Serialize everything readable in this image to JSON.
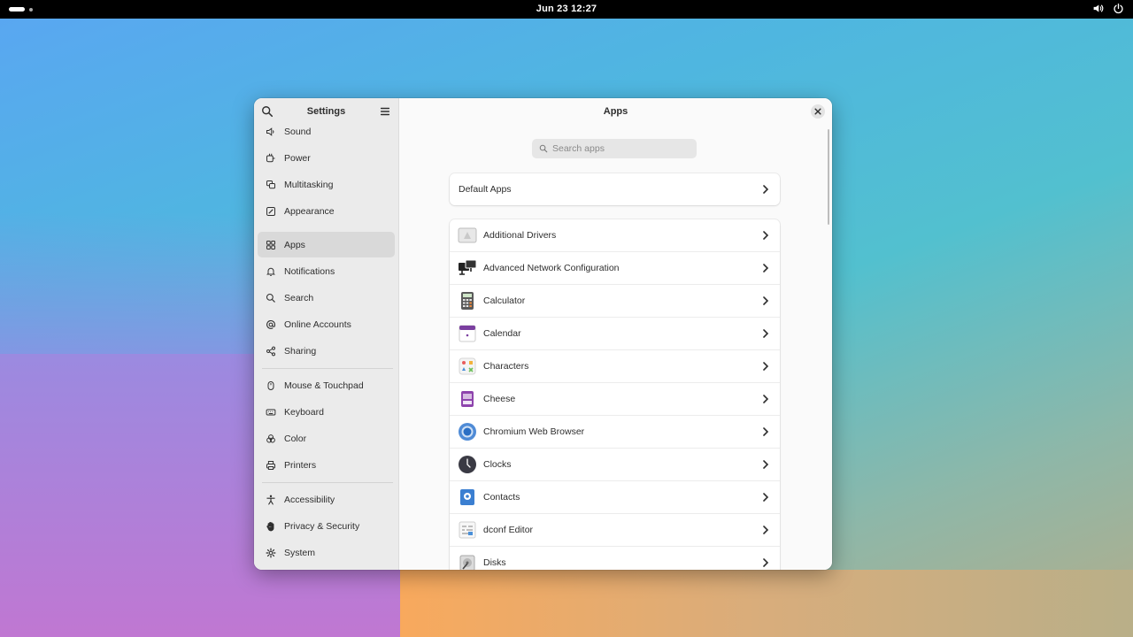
{
  "topbar": {
    "clock": "Jun 23  12:27"
  },
  "sidebar": {
    "title": "Settings",
    "items": [
      {
        "label": "Sound",
        "icon": "speaker-icon"
      },
      {
        "label": "Power",
        "icon": "power-plug-icon"
      },
      {
        "label": "Multitasking",
        "icon": "multitasking-icon"
      },
      {
        "label": "Appearance",
        "icon": "appearance-icon"
      },
      {
        "label": "Apps",
        "icon": "apps-grid-icon"
      },
      {
        "label": "Notifications",
        "icon": "bell-icon"
      },
      {
        "label": "Search",
        "icon": "search-icon"
      },
      {
        "label": "Online Accounts",
        "icon": "at-sign-icon"
      },
      {
        "label": "Sharing",
        "icon": "share-icon"
      },
      {
        "label": "Mouse & Touchpad",
        "icon": "mouse-icon"
      },
      {
        "label": "Keyboard",
        "icon": "keyboard-icon"
      },
      {
        "label": "Color",
        "icon": "color-icon"
      },
      {
        "label": "Printers",
        "icon": "printer-icon"
      },
      {
        "label": "Accessibility",
        "icon": "accessibility-icon"
      },
      {
        "label": "Privacy & Security",
        "icon": "hand-icon"
      },
      {
        "label": "System",
        "icon": "gear-icon"
      }
    ],
    "active": "Apps"
  },
  "content": {
    "title": "Apps",
    "search_placeholder": "Search apps",
    "default_apps_label": "Default Apps",
    "apps": [
      {
        "label": "Additional Drivers",
        "icon": "drivers-icon"
      },
      {
        "label": "Advanced Network Configuration",
        "icon": "network-icon"
      },
      {
        "label": "Calculator",
        "icon": "calculator-icon"
      },
      {
        "label": "Calendar",
        "icon": "calendar-icon"
      },
      {
        "label": "Characters",
        "icon": "characters-icon"
      },
      {
        "label": "Cheese",
        "icon": "cheese-icon"
      },
      {
        "label": "Chromium Web Browser",
        "icon": "chromium-icon"
      },
      {
        "label": "Clocks",
        "icon": "clock-icon"
      },
      {
        "label": "Contacts",
        "icon": "contacts-icon"
      },
      {
        "label": "dconf Editor",
        "icon": "dconf-icon"
      },
      {
        "label": "Disks",
        "icon": "disks-icon"
      }
    ]
  }
}
